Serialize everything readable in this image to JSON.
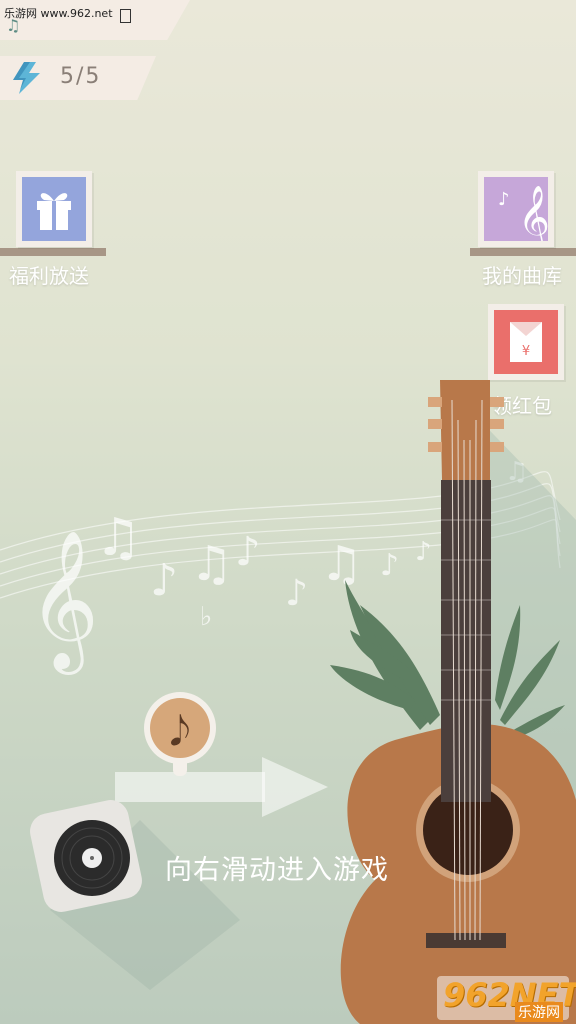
{
  "watermark": {
    "site": "乐游网 www.962.net",
    "corner_logo": "962NET",
    "corner_sub": "乐游网"
  },
  "energy": {
    "icon": "lightning-icon",
    "value": "5/5"
  },
  "buttons": {
    "gift": {
      "label": "福利放送",
      "icon": "gift-icon"
    },
    "library": {
      "label": "我的曲库",
      "icon": "music-note-icon"
    },
    "red_packet": {
      "label": "领红包",
      "icon": "red-envelope-icon",
      "symbol": "¥"
    }
  },
  "slider": {
    "hint": "向右滑动进入游戏"
  },
  "colors": {
    "gift_tile": "#94a5dc",
    "library_tile": "#c6a7d9",
    "red_tile": "#ea6f6b",
    "guitar": "#b8784a"
  }
}
